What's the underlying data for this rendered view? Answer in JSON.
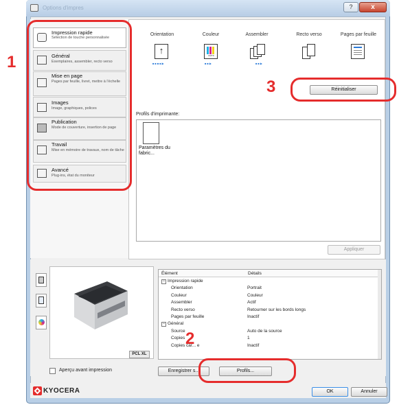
{
  "window": {
    "title": "Options d'impression",
    "help_label": "?",
    "close_label": "x"
  },
  "sidebar": {
    "items": [
      {
        "title": "Impression rapide",
        "desc": "Sélection de touche personnalisée"
      },
      {
        "title": "Général",
        "desc": "Exemplaires, assembler, recto verso"
      },
      {
        "title": "Mise en page",
        "desc": "Pages par feuille, livret, mettre à l'échelle"
      },
      {
        "title": "Images",
        "desc": "Image, graphiques, polices"
      },
      {
        "title": "Publication",
        "desc": "Mode de couverture, insertion de page"
      },
      {
        "title": "Travail",
        "desc": "Mise en mémoire de travaux, nom de tâche"
      },
      {
        "title": "Avancé",
        "desc": "Plug-ins, état du moniteur"
      }
    ]
  },
  "quick_print": {
    "headers": [
      "Orientation",
      "Couleur",
      "Assembler",
      "Recto verso",
      "Pages par feuille"
    ],
    "color_icon_text": "CMYK",
    "reset_label": "Réinitialiser",
    "profiles_label": "Profils d'imprimante:",
    "profile_item": "Paramètres du fabric...",
    "apply_label": "Appliquer"
  },
  "preview": {
    "pcl_badge": "PCL XL",
    "checkbox_label": "Aperçu avant impression"
  },
  "details": {
    "col_element": "Élément",
    "col_details": "Détails",
    "rows": [
      {
        "indent": 0,
        "expander": "−",
        "key": "Impression rapide",
        "value": ""
      },
      {
        "indent": 1,
        "expander": "",
        "key": "Orientation",
        "value": "Portrait"
      },
      {
        "indent": 1,
        "expander": "",
        "key": "Couleur",
        "value": "Couleur"
      },
      {
        "indent": 1,
        "expander": "",
        "key": "Assembler",
        "value": "Actif"
      },
      {
        "indent": 1,
        "expander": "",
        "key": "Recto verso",
        "value": "Retourner sur les bords longs"
      },
      {
        "indent": 1,
        "expander": "",
        "key": "Pages par feuille",
        "value": "Inactif"
      },
      {
        "indent": 0,
        "expander": "−",
        "key": "Général",
        "value": ""
      },
      {
        "indent": 1,
        "expander": "",
        "key": "Source",
        "value": "Auto de la source"
      },
      {
        "indent": 1,
        "expander": "",
        "key": "Copies",
        "value": "1"
      },
      {
        "indent": 1,
        "expander": "",
        "key": "Copies car... e",
        "value": "Inactif"
      }
    ]
  },
  "buttons": {
    "save_label": "Enregistrer s...",
    "profiles_label": "Profils...",
    "ok_label": "OK",
    "cancel_label": "Annuler"
  },
  "brand": {
    "logo_text": "KYOCERA",
    "logo_color": "#e52c2c"
  },
  "callouts": {
    "one": "1",
    "two": "2",
    "three": "3",
    "color": "#e52c2c"
  }
}
